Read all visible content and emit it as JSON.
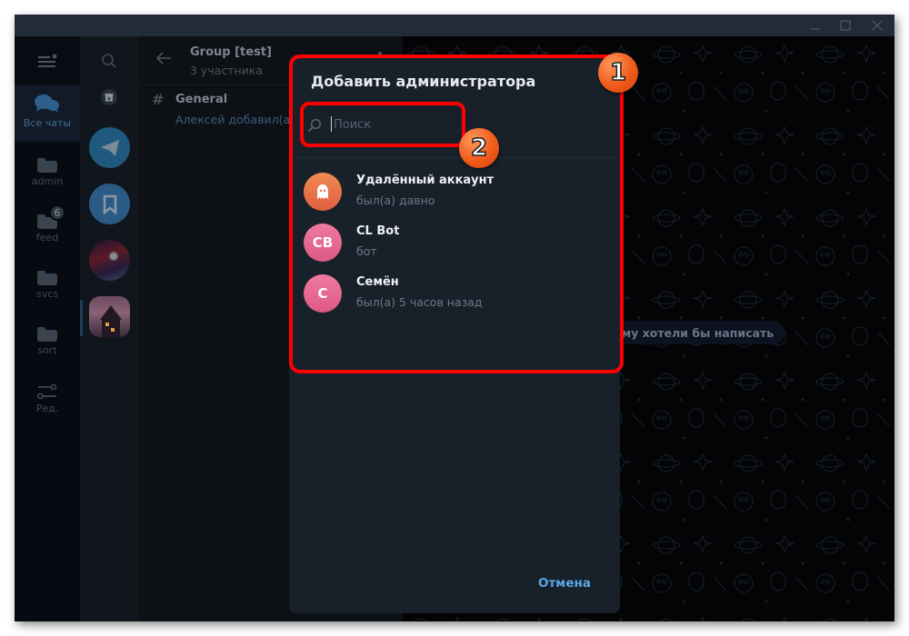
{
  "window": {
    "controls": {
      "minimize_icon": "minimize-icon",
      "maximize_icon": "maximize-icon",
      "close_icon": "close-icon"
    }
  },
  "folders": {
    "items": [
      {
        "id": "all",
        "label": "Все чаты",
        "icon": "chats-icon",
        "active": true
      },
      {
        "id": "admin",
        "label": "admin",
        "icon": "folder-icon"
      },
      {
        "id": "feed",
        "label": "feed",
        "icon": "folder-icon",
        "badge": "6"
      },
      {
        "id": "svcs",
        "label": "svcs",
        "icon": "folder-icon"
      },
      {
        "id": "sort",
        "label": "sort",
        "icon": "folder-icon"
      },
      {
        "id": "edit",
        "label": "Ред.",
        "icon": "sliders-icon"
      }
    ]
  },
  "chatlist": {
    "avatars": [
      "Telegram",
      "Saved Messages",
      "Sky chat",
      "House chat"
    ]
  },
  "topics": {
    "group_title": "Group [test]",
    "group_subtitle": "3 участника",
    "items": [
      {
        "hash": "#",
        "name": "General",
        "last_message": "Алексей добавил(а) С"
      }
    ]
  },
  "chat": {
    "hint": "му хотели бы написать"
  },
  "dialog": {
    "title": "Добавить администратора",
    "search": {
      "placeholder": "Поиск",
      "value": ""
    },
    "members": [
      {
        "name": "Удалённый аккаунт",
        "status": "был(а) давно",
        "initials": "",
        "avatar_color": "#e8704a",
        "avatar_icon": "ghost-icon"
      },
      {
        "name": "CL Bot",
        "status": "бот",
        "initials": "CB",
        "avatar_color": "#e5648f"
      },
      {
        "name": "Семён",
        "status": "был(а) 5 часов назад",
        "initials": "С",
        "avatar_color": "#e5648f"
      }
    ],
    "cancel_label": "Отмена"
  },
  "annotations": {
    "step1": "1",
    "step2": "2",
    "highlight_color": "#ff0000",
    "badge_color": "#f05a1a"
  },
  "colors": {
    "accent": "#5ba6e6",
    "dialog_bg": "#18202a",
    "titlebar": "#222b38"
  }
}
